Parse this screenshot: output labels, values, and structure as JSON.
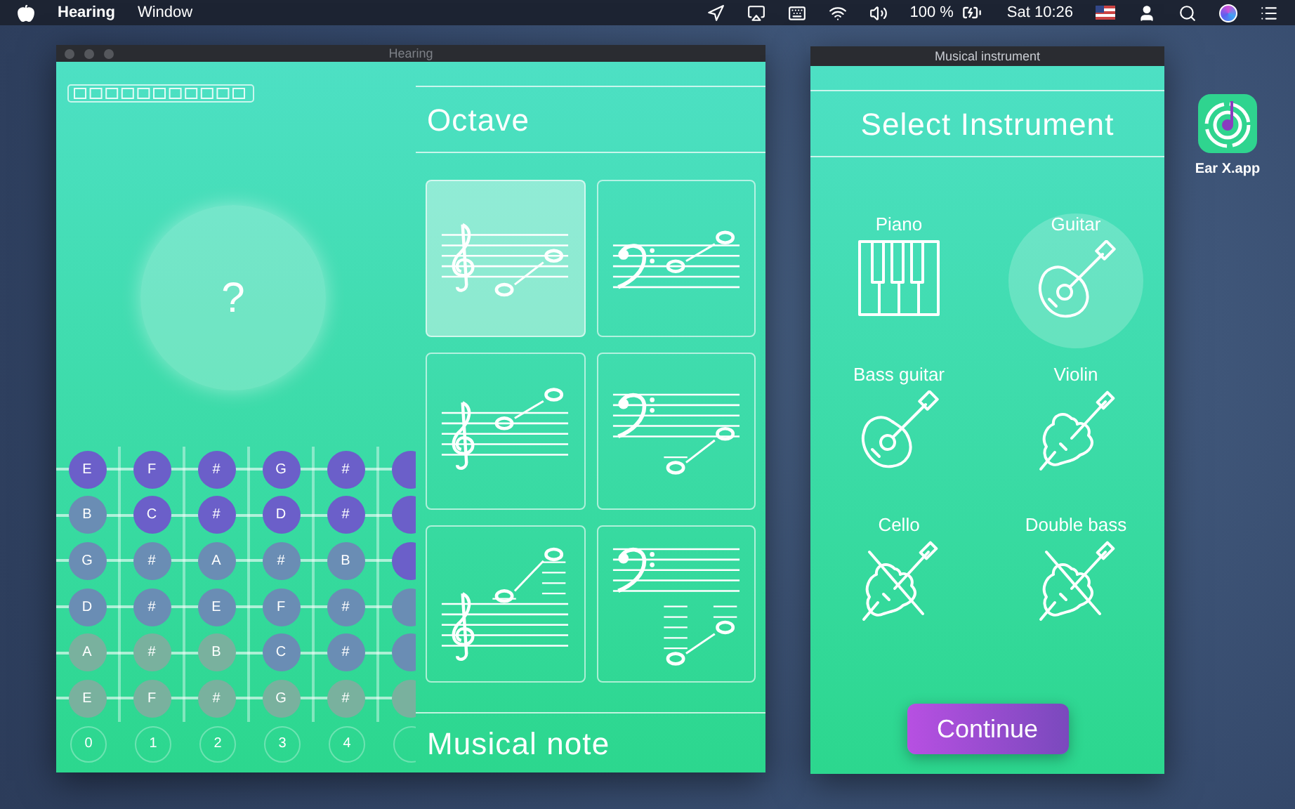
{
  "menu_bar": {
    "app_name": "Hearing",
    "menus": [
      "Window"
    ],
    "battery_percent": "100 %",
    "clock": "Sat 10:26"
  },
  "hearing_window": {
    "title": "Hearing",
    "question_mark": "?",
    "fretboard": [
      [
        {
          "note": "E",
          "color": "#6b5fc9"
        },
        {
          "note": "F",
          "color": "#6b5fc9"
        },
        {
          "note": "#",
          "color": "#6b5fc9"
        },
        {
          "note": "G",
          "color": "#6b5fc9"
        },
        {
          "note": "#",
          "color": "#6b5fc9"
        },
        {
          "color": "#6b5fc9"
        }
      ],
      [
        {
          "note": "B",
          "color": "#6a8db4"
        },
        {
          "note": "C",
          "color": "#6b5fc9"
        },
        {
          "note": "#",
          "color": "#6b5fc9"
        },
        {
          "note": "D",
          "color": "#6b5fc9"
        },
        {
          "note": "#",
          "color": "#6b5fc9"
        },
        {
          "color": "#6b5fc9"
        }
      ],
      [
        {
          "note": "G",
          "color": "#6a8db4"
        },
        {
          "note": "#",
          "color": "#6a8db4"
        },
        {
          "note": "A",
          "color": "#6a8db4"
        },
        {
          "note": "#",
          "color": "#6a8db4"
        },
        {
          "note": "B",
          "color": "#6a8db4"
        },
        {
          "color": "#6b5fc9"
        }
      ],
      [
        {
          "note": "D",
          "color": "#6a8db4"
        },
        {
          "note": "#",
          "color": "#6a8db4"
        },
        {
          "note": "E",
          "color": "#6a8db4"
        },
        {
          "note": "F",
          "color": "#6a8db4"
        },
        {
          "note": "#",
          "color": "#6a8db4"
        },
        {
          "color": "#6a8db4"
        }
      ],
      [
        {
          "note": "A",
          "color": "#79b19e"
        },
        {
          "note": "#",
          "color": "#79b19e"
        },
        {
          "note": "B",
          "color": "#79b19e"
        },
        {
          "note": "C",
          "color": "#6a8db4"
        },
        {
          "note": "#",
          "color": "#6a8db4"
        },
        {
          "color": "#6a8db4"
        }
      ],
      [
        {
          "note": "E",
          "color": "#79b19e"
        },
        {
          "note": "F",
          "color": "#79b19e"
        },
        {
          "note": "#",
          "color": "#79b19e"
        },
        {
          "note": "G",
          "color": "#79b19e"
        },
        {
          "note": "#",
          "color": "#79b19e"
        },
        {
          "color": "#79b19e"
        }
      ]
    ],
    "fret_numbers": [
      "0",
      "1",
      "2",
      "3",
      "4"
    ],
    "octave_heading": "Octave",
    "octave_options": [
      {
        "kind": "treble",
        "selected": true
      },
      {
        "kind": "bass",
        "selected": false
      },
      {
        "kind": "treble",
        "selected": false
      },
      {
        "kind": "bass",
        "selected": false
      },
      {
        "kind": "treble",
        "selected": false
      },
      {
        "kind": "bass",
        "selected": false
      }
    ],
    "footer_heading": "Musical note"
  },
  "instrument_window": {
    "title": "Musical instrument",
    "heading": "Select Instrument",
    "instruments": [
      {
        "label": "Piano",
        "kind": "piano",
        "selected": false
      },
      {
        "label": "Guitar",
        "kind": "guitar",
        "selected": true
      },
      {
        "label": "Bass guitar",
        "kind": "guitar",
        "selected": false
      },
      {
        "label": "Violin",
        "kind": "violin",
        "selected": false
      },
      {
        "label": "Cello",
        "kind": "bowed",
        "selected": false
      },
      {
        "label": "Double bass",
        "kind": "bowed",
        "selected": false
      }
    ],
    "continue_button": "Continue"
  },
  "desktop_icon": {
    "label": "Ear X.app"
  }
}
